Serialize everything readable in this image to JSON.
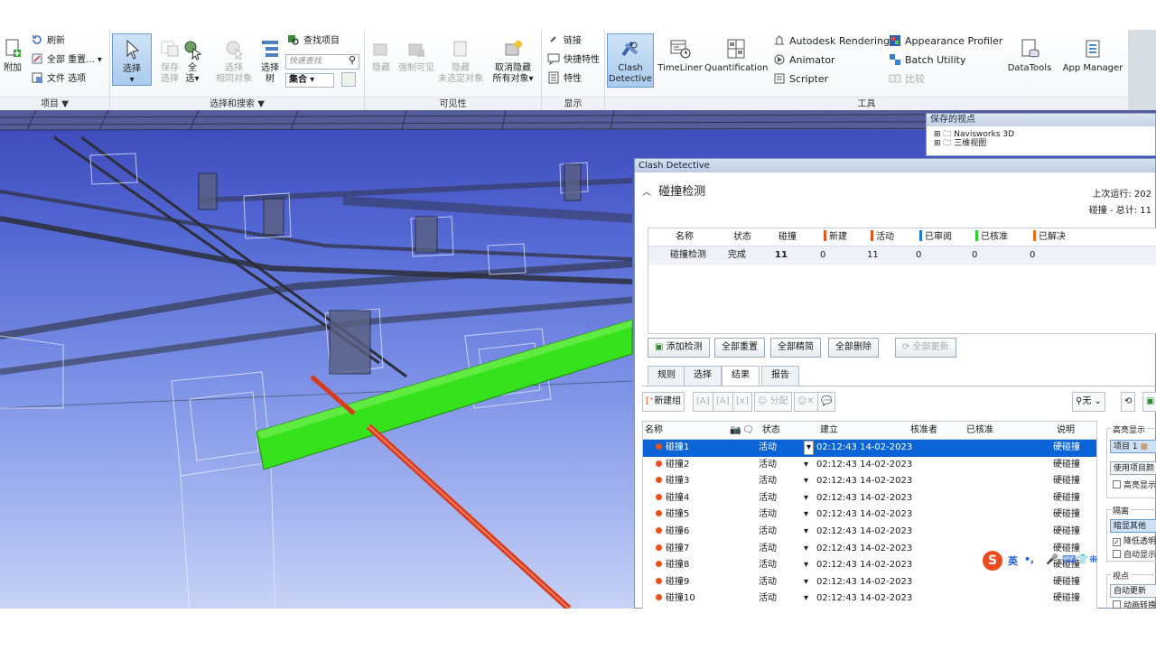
{
  "ribbon": {
    "groups": {
      "project": "项目 ▼",
      "select_search": "选择和搜索 ▼",
      "visibility": "可见性",
      "display": "显示",
      "tools": "工具"
    },
    "project": {
      "append": "附加",
      "refresh": "刷新",
      "reset_all": "全部 重置...",
      "file_options": "文件 选项"
    },
    "select": {
      "select": "选择",
      "save_select_1": "保存",
      "save_select_2": "选择",
      "select_all_1": "全",
      "select_all_2": "选",
      "select_same_1": "选择",
      "select_same_2": "相同对象",
      "select_tree_1": "选择",
      "select_tree_2": "树",
      "find_items": "查找项目",
      "quick_find_placeholder": "快速查找",
      "sets": "集合"
    },
    "visibility": {
      "hide": "隐藏",
      "require": "强制可见",
      "hide_unselected_1": "隐藏",
      "hide_unselected_2": "未选定对象",
      "unhide_all_1": "取消隐藏",
      "unhide_all_2": "所有对象"
    },
    "display": {
      "links": "链接",
      "quick_properties": "快捷特性",
      "properties": "特性"
    },
    "tools": {
      "clash_1": "Clash",
      "clash_2": "Detective",
      "timeliner": "TimeLiner",
      "quantification": "Quantification",
      "autodesk_rendering": "Autodesk Rendering",
      "animator": "Animator",
      "scripter": "Scripter",
      "appearance_profiler": "Appearance Profiler",
      "batch_utility": "Batch Utility",
      "compare": "比较",
      "datatools": "DataTools",
      "app_manager": "App Manager"
    }
  },
  "saved_viewpoints": {
    "title": "保存的视点",
    "nodes": [
      "Navisworks 3D",
      "三维视图"
    ]
  },
  "clash": {
    "window_title": "Clash Detective",
    "section_title": "碰撞检测",
    "last_run": "上次运行: 202",
    "total": "碰撞 - 总计: 11",
    "tests_header": {
      "name": "名称",
      "status": "状态",
      "clashes": "碰撞",
      "new": "新建",
      "active": "活动",
      "reviewed": "已审阅",
      "approved": "已核准",
      "resolved": "已解决"
    },
    "tests_row": {
      "name": "碰撞检测",
      "status": "完成",
      "clashes": "11",
      "new": "0",
      "active": "11",
      "reviewed": "0",
      "approved": "0",
      "resolved": "0"
    },
    "buttons": {
      "add_test": "添加检测",
      "reset_all": "全部重置",
      "compact_all": "全部精简",
      "delete_all": "全部删除",
      "update_all": "全部更新"
    },
    "tabs": [
      "规则",
      "选择",
      "结果",
      "报告"
    ],
    "results_toolbar": {
      "new_group": "新建组",
      "assign": "分配",
      "filter": "无"
    },
    "results_header": {
      "name": "名称",
      "status": "状态",
      "found": "建立",
      "approved_by": "核准者",
      "approved": "已核准",
      "description": "说明"
    },
    "results": [
      {
        "name": "碰撞1",
        "status": "活动",
        "found": "02:12:43 14-02-2023",
        "desc": "硬碰撞"
      },
      {
        "name": "碰撞2",
        "status": "活动",
        "found": "02:12:43 14-02-2023",
        "desc": "硬碰撞"
      },
      {
        "name": "碰撞3",
        "status": "活动",
        "found": "02:12:43 14-02-2023",
        "desc": "硬碰撞"
      },
      {
        "name": "碰撞4",
        "status": "活动",
        "found": "02:12:43 14-02-2023",
        "desc": "硬碰撞"
      },
      {
        "name": "碰撞5",
        "status": "活动",
        "found": "02:12:43 14-02-2023",
        "desc": "硬碰撞"
      },
      {
        "name": "碰撞6",
        "status": "活动",
        "found": "02:12:43 14-02-2023",
        "desc": "硬碰撞"
      },
      {
        "name": "碰撞7",
        "status": "活动",
        "found": "02:12:43 14-02-2023",
        "desc": "硬碰撞"
      },
      {
        "name": "碰撞8",
        "status": "活动",
        "found": "02:12:43 14-02-2023",
        "desc": "硬碰撞"
      },
      {
        "name": "碰撞9",
        "status": "活动",
        "found": "02:12:43 14-02-2023",
        "desc": "硬碰撞"
      },
      {
        "name": "碰撞10",
        "status": "活动",
        "found": "02:12:43 14-02-2023",
        "desc": "硬碰撞"
      }
    ],
    "side": {
      "highlight": "高亮显示",
      "item1": "项目 1",
      "use_item_color": "使用项目颜",
      "highlight_all": "高亮显示",
      "isolate": "隔离",
      "dim_others": "暗显其他",
      "reduce_transparency": "降低透明",
      "auto_reveal": "自动显示",
      "viewpoint": "视点",
      "auto_update": "自动更新",
      "animate": "动画转换"
    }
  },
  "ime": {
    "lang": "英",
    "punct": "•,"
  },
  "colors": {
    "status_new": "#e8531c",
    "status_active": "#e8531c",
    "status_reviewed": "#1d78e0",
    "status_approved": "#2ad12a",
    "status_resolved": "#ef6a12",
    "selected_row": "#0a64d6",
    "green_duct": "#36e21c",
    "red_pipe": "#d83a1e"
  }
}
